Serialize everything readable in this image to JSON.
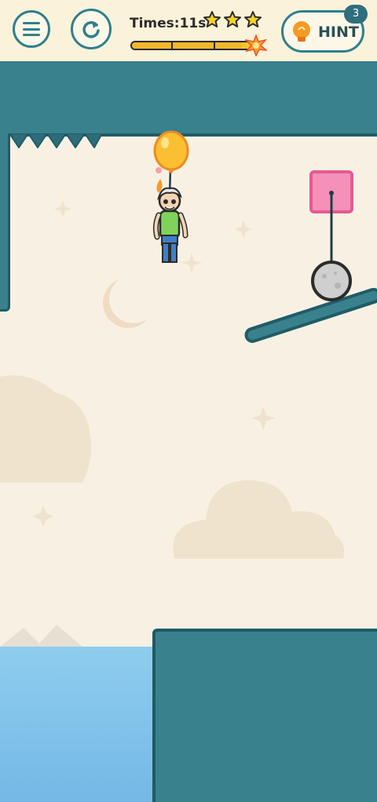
{
  "hud": {
    "timer_text": "Times:11s",
    "stars_lit": 3,
    "stars_total": 3,
    "time_remaining_fraction": 0.9,
    "hint_label": "HINT",
    "hint_count": "3"
  },
  "icons": {
    "menu": "hamburger-menu-icon",
    "restart": "restart-arrow-icon",
    "star": "star-icon",
    "hint": "lightbulb-icon"
  },
  "colors": {
    "accent_teal": "#39818d",
    "teal_dark": "#205c67",
    "background": "#f8f1e3",
    "star_yellow": "#f5d22a",
    "water": "#86c6ed",
    "pink_anchor": "#f590b8",
    "balloon": "#fbbf33"
  },
  "level": {
    "character": "old-man-stickman",
    "balloon": "yellow-balloon",
    "anchor_block": "pink-block",
    "hanging_weight": "grey-stone-ball",
    "hazard": "ceiling-spikes",
    "water": "water-pool"
  }
}
